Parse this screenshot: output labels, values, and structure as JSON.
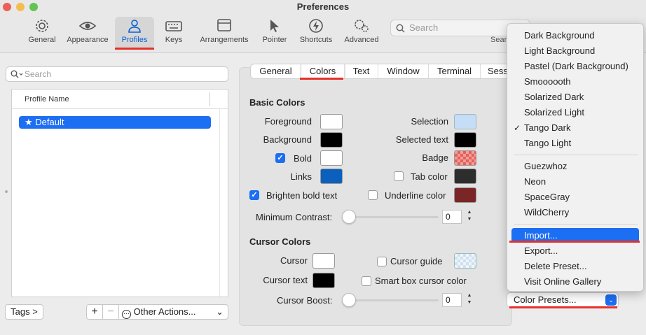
{
  "window": {
    "title": "Preferences"
  },
  "toolbar": {
    "items": [
      {
        "label": "General",
        "icon": "gear-icon"
      },
      {
        "label": "Appearance",
        "icon": "eye-icon"
      },
      {
        "label": "Profiles",
        "icon": "person-icon",
        "selected": true
      },
      {
        "label": "Keys",
        "icon": "keyboard-icon"
      },
      {
        "label": "Arrangements",
        "icon": "window-icon"
      },
      {
        "label": "Pointer",
        "icon": "pointer-icon"
      },
      {
        "label": "Shortcuts",
        "icon": "bolt-icon"
      },
      {
        "label": "Advanced",
        "icon": "gears-icon"
      }
    ],
    "search_placeholder": "Search",
    "search_sublabel": "Sear"
  },
  "profiles": {
    "search_placeholder": "Search",
    "column_header": "Profile Name",
    "items": [
      {
        "label": "Default",
        "starred": true,
        "selected": true
      }
    ],
    "tags_button": "Tags >",
    "add_button": "+",
    "remove_button": "−",
    "other_actions": "Other Actions..."
  },
  "tabs": [
    "General",
    "Colors",
    "Text",
    "Window",
    "Terminal",
    "Sess"
  ],
  "selected_tab": "Colors",
  "basic_colors": {
    "title": "Basic Colors",
    "foreground": "Foreground",
    "background": "Background",
    "bold": "Bold",
    "links": "Links",
    "brighten": "Brighten bold text",
    "selection": "Selection",
    "selected_text": "Selected text",
    "badge": "Badge",
    "tab_color": "Tab color",
    "underline_color": "Underline color",
    "min_contrast": "Minimum Contrast:",
    "min_contrast_value": "0"
  },
  "cursor_colors": {
    "title": "Cursor Colors",
    "cursor": "Cursor",
    "cursor_text": "Cursor text",
    "cursor_guide": "Cursor guide",
    "smart_box": "Smart box cursor color",
    "cursor_boost": "Cursor Boost:",
    "cursor_boost_value": "0"
  },
  "colors": {
    "foreground": "#ffffff",
    "background": "#000000",
    "bold": "#ffffff",
    "links": "#0b5fbd",
    "selection": "#c6ddf7",
    "selected_text": "#000000",
    "tab_color": "#2d2d2d",
    "underline_color": "#7a2626",
    "cursor": "#ffffff",
    "cursor_text": "#000000",
    "accent": "#1c6ef2",
    "annotation_red": "#e5312b"
  },
  "preset_menu": {
    "group1": [
      "Dark Background",
      "Light Background",
      "Pastel (Dark Background)",
      "Smoooooth",
      "Solarized Dark",
      "Solarized Light",
      "Tango Dark",
      "Tango Light"
    ],
    "checked": "Tango Dark",
    "group2": [
      "Guezwhoz",
      "Neon",
      "SpaceGray",
      "WildCherry"
    ],
    "group3": [
      "Import...",
      "Export...",
      "Delete Preset...",
      "Visit Online Gallery"
    ],
    "highlighted": "Import..."
  },
  "color_presets_button": "Color Presets..."
}
